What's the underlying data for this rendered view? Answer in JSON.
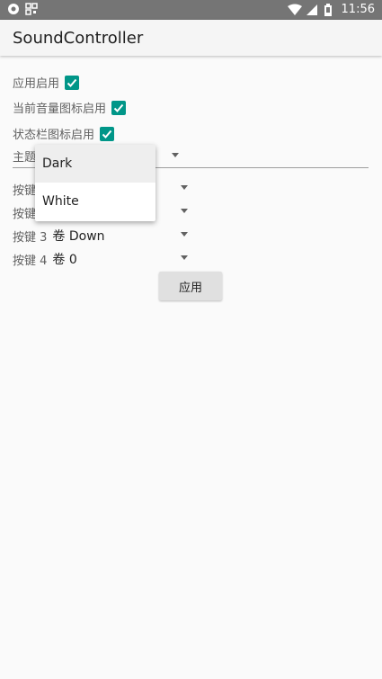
{
  "status_bar": {
    "time": "11:56",
    "left_icons": [
      "record-icon",
      "qr-icon"
    ],
    "right_icons": [
      "wifi-icon",
      "signal-icon",
      "battery-icon"
    ]
  },
  "toolbar": {
    "title": "SoundController"
  },
  "settings": {
    "app_enabled_label": "应用启用",
    "volume_icon_label": "当前音量图标启用",
    "statusbar_icon_label": "状态栏图标启用",
    "theme_label": "主题",
    "keys": [
      {
        "label": "按键",
        "value": ""
      },
      {
        "label": "按键",
        "value": ""
      },
      {
        "label": "按键 3",
        "value": "卷 Down"
      },
      {
        "label": "按键 4",
        "value": "卷 0"
      }
    ],
    "apply_button": "应用"
  },
  "theme_dropdown": {
    "options": [
      "Dark",
      "White"
    ],
    "selected": "Dark"
  },
  "colors": {
    "accent": "#009688",
    "status_bar": "#757575",
    "toolbar": "#f5f5f5"
  }
}
